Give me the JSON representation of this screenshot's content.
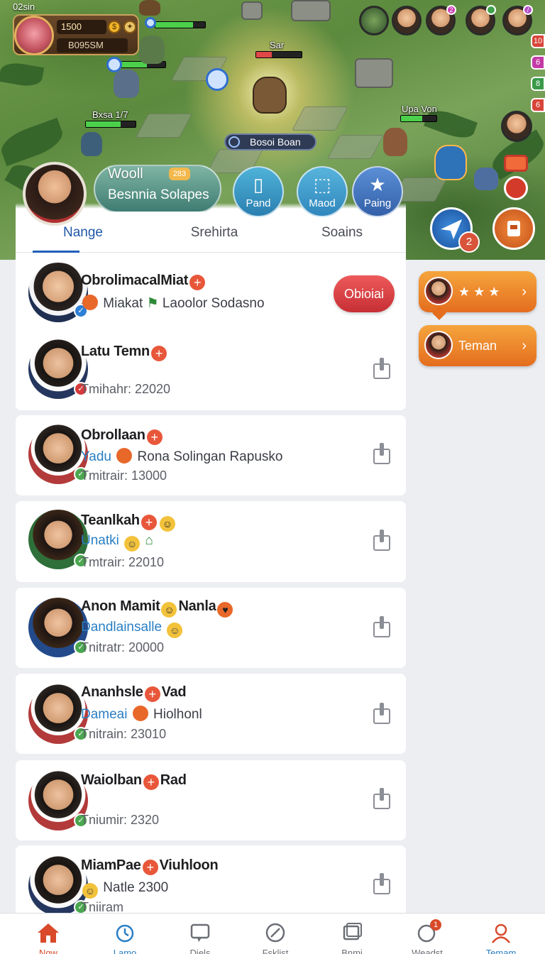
{
  "game": {
    "top_left_text": "02sin",
    "hero_level": "1500",
    "hero_name": "B095SM",
    "unit_labels": [
      "Sar",
      "Bxsa 1/7",
      "Upa Von"
    ],
    "boss_banner": "Bosoi Boan",
    "teammate_badges": [
      "",
      "",
      "2",
      "",
      "7"
    ],
    "side_pills": [
      "10",
      "6",
      "8",
      "6"
    ],
    "round_badge": "2"
  },
  "profile": {
    "name": "Wooll",
    "badge": "283",
    "subtitle": "Besnnia Solapes",
    "quick_actions": [
      {
        "label": "Pand",
        "icon": "clipboard-icon"
      },
      {
        "label": "Maod",
        "icon": "box-icon"
      },
      {
        "label": "Paing",
        "icon": "star-icon"
      }
    ]
  },
  "tabs": [
    {
      "label": "Nange",
      "active": true
    },
    {
      "label": "Srehirta",
      "active": false
    },
    {
      "label": "Soains",
      "active": false
    }
  ],
  "side_buttons": [
    {
      "label": "★ ★ ★",
      "chevron": "›"
    },
    {
      "label": "Teman",
      "chevron": "›"
    }
  ],
  "friends": [
    {
      "name": "ObrolimacalMiat",
      "sub_prefix": "",
      "sub_text": "Miakat",
      "sub_suffix": "Laoolor Sodasno",
      "meta": "",
      "action": "Obioiai",
      "status": "blue"
    },
    {
      "name": "Latu Temn",
      "sub_prefix": "",
      "sub_text": "",
      "sub_suffix": "",
      "meta": "Tmihahr: 22020",
      "status": "red"
    },
    {
      "name": "Obrollaan",
      "sub_prefix": "Yadu",
      "sub_text": "",
      "sub_suffix": "Rona Solingan Rapusko",
      "meta": "Tmitrair: 13000",
      "status": "green"
    },
    {
      "name": "Teanlkah",
      "sub_prefix": "Unatki",
      "sub_text": "",
      "sub_suffix": "",
      "meta": "Tmtrair: 22010",
      "status": "green"
    },
    {
      "name": "Anon Mamit",
      "name_tail": "Nanla",
      "sub_prefix": "Dandlainsalle",
      "sub_text": "",
      "sub_suffix": "",
      "meta": "Tnitratr: 20000",
      "status": "green"
    },
    {
      "name": "Ananhsle",
      "name_tail": "Vad",
      "sub_prefix": "Dameai",
      "sub_text": "",
      "sub_suffix": "Hiolhonl",
      "meta": "Tnitrain: 23010",
      "status": "green"
    },
    {
      "name": "Waiolban",
      "name_tail": "Rad",
      "sub_prefix": "",
      "sub_text": "",
      "sub_suffix": "",
      "meta": "Tniumir: 2320",
      "status": "green"
    },
    {
      "name": "MiamPae",
      "name_tail": "Viuhloon",
      "sub_prefix": "",
      "sub_text": "",
      "sub_suffix": "Natle 2300",
      "meta": "Tniiram",
      "status": "green"
    }
  ],
  "bottom_nav": [
    {
      "label": "Ngw",
      "icon": "home-icon",
      "active": true
    },
    {
      "label": "Lamo",
      "icon": "alarm-icon",
      "active": false
    },
    {
      "label": "Diels",
      "icon": "chat-icon",
      "active": false
    },
    {
      "label": "Fsklist",
      "icon": "compass-icon",
      "active": false
    },
    {
      "label": "Bnmi",
      "icon": "cards-icon",
      "active": false
    },
    {
      "label": "Weadst",
      "icon": "bubble-icon",
      "badge": "1",
      "active": false
    },
    {
      "label": "Temam",
      "icon": "person-icon",
      "active": false
    }
  ],
  "colors": {
    "accent_blue": "#1f57a8",
    "action_red": "#d43a3a",
    "side_orange": "#e46d1e",
    "status_green": "#4aa74f"
  }
}
